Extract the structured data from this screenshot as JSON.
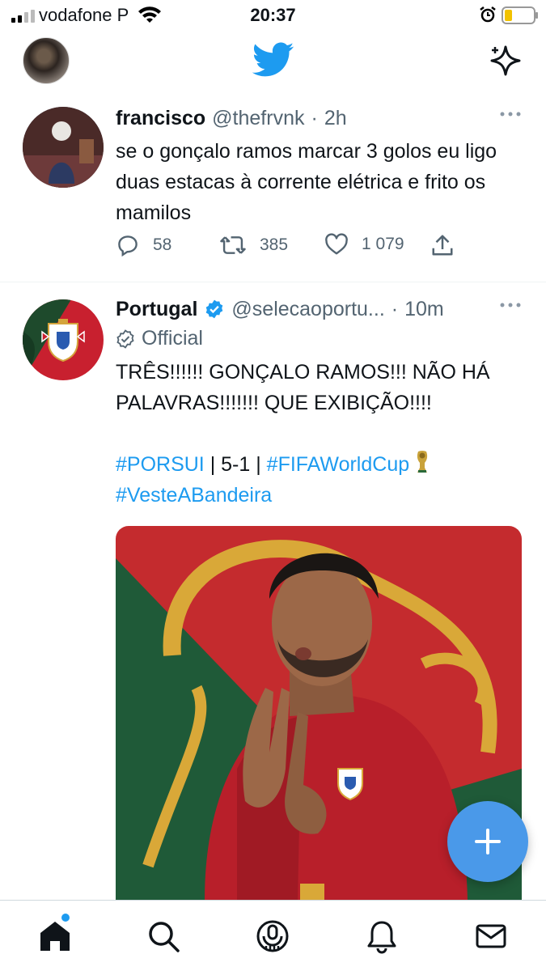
{
  "status_bar": {
    "carrier": "vodafone P",
    "time": "20:37"
  },
  "colors": {
    "twitter_blue": "#1d9bf0",
    "text_primary": "#0f1419",
    "text_secondary": "#536471",
    "verified_blue": "#1d9bf0",
    "fab": "#4a99e9"
  },
  "top_nav": {
    "logo_icon": "twitter-bird-icon",
    "right_icon": "sparkle-icon"
  },
  "tweets": [
    {
      "name": "francisco",
      "handle": "@thefrvnk",
      "separator": "·",
      "time": "2h",
      "text": "se o gonçalo ramos marcar 3 golos eu ligo duas estacas à corrente elétrica e frito os mamilos",
      "replies": "58",
      "retweets": "385",
      "likes": "1 079"
    },
    {
      "name": "Portugal",
      "handle": "@selecaoportu...",
      "separator": "·",
      "time": "10m",
      "official_label": "Official",
      "text_line1": "TRÊS!!!!!! GONÇALO RAMOS!!! NÃO HÁ PALAVRAS!!!!!!! QUE EXIBIÇÃO!!!!",
      "hashtag1": "#PORSUI",
      "score_text": " | 5-1 | ",
      "hashtag2": "#FIFAWorldCup",
      "hashtag3": "#VesteABandeira"
    }
  ],
  "bottom_nav": [
    "home-icon",
    "search-icon",
    "spaces-icon",
    "notifications-icon",
    "messages-icon"
  ]
}
